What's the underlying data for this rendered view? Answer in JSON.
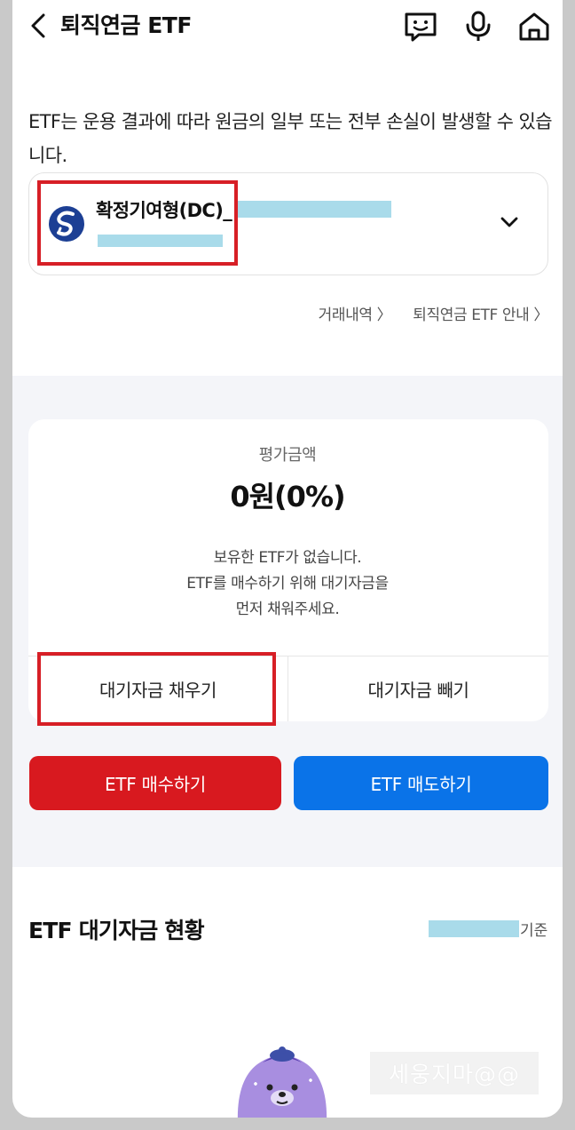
{
  "header": {
    "title": "퇴직연금 ETF",
    "icons": [
      "back-arrow-icon",
      "chat-bot-icon",
      "microphone-icon",
      "home-icon"
    ]
  },
  "notice": "ETF는 운용 결과에 따라 원금의 일부 또는 전부 손실이 발생할 수 있습니다.",
  "account": {
    "name": "확정기여형(DC)_",
    "bank_logo": "shinhan-logo-icon"
  },
  "links": {
    "history": "거래내역 〉",
    "guide": "퇴직연금 ETF 안내 〉"
  },
  "evaluation": {
    "label": "평가금액",
    "value": "0원(0%)",
    "empty_line1": "보유한 ETF가 없습니다.",
    "empty_line2": "ETF를 매수하기 위해 대기자금을",
    "empty_line3": "먼저 채워주세요."
  },
  "card_buttons": {
    "fill": "대기자금 채우기",
    "withdraw": "대기자금 빼기"
  },
  "trade_buttons": {
    "buy": "ETF 매수하기",
    "sell": "ETF 매도하기"
  },
  "standby_section": {
    "title": "ETF 대기자금 현황",
    "basis": "기준"
  },
  "watermark": "세웅지마@@",
  "colors": {
    "buy": "#d8191f",
    "sell": "#0a73e8",
    "highlight_box": "#d71f26",
    "redaction": "#a9dbea",
    "band": "#f4f5f9"
  }
}
